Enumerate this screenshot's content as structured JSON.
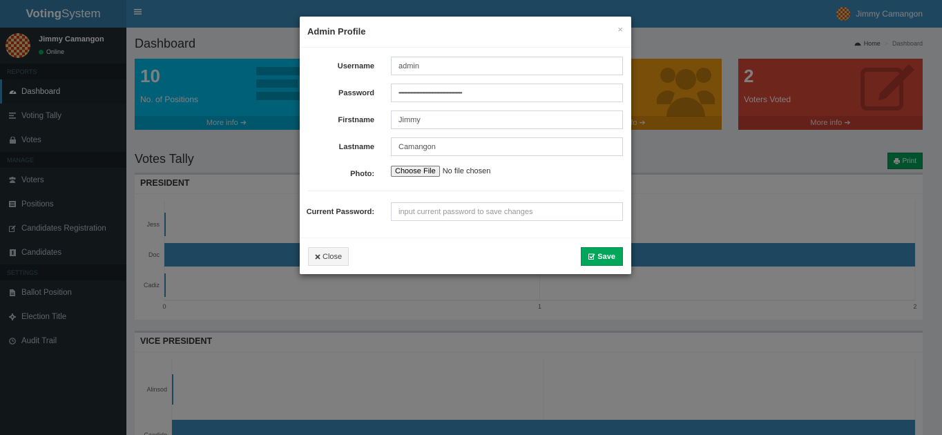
{
  "header": {
    "logo_bold": "Voting",
    "logo_rest": "System",
    "user_name": "Jimmy Camangon"
  },
  "sidebar": {
    "user_name": "Jimmy Camangon",
    "status": "Online",
    "sections": {
      "reports": "REPORTS",
      "manage": "MANAGE",
      "settings": "SETTINGS"
    },
    "items": [
      {
        "label": "Dashboard",
        "icon": "dashboard-icon"
      },
      {
        "label": "Voting Tally",
        "icon": "tally-icon"
      },
      {
        "label": "Votes",
        "icon": "lock-icon"
      },
      {
        "label": "Voters",
        "icon": "users-icon"
      },
      {
        "label": "Positions",
        "icon": "tasks-icon"
      },
      {
        "label": "Candidates Registration",
        "icon": "edit-icon"
      },
      {
        "label": "Candidates",
        "icon": "id-card-icon"
      },
      {
        "label": "Ballot Position",
        "icon": "file-icon"
      },
      {
        "label": "Election Title",
        "icon": "cog-icon"
      },
      {
        "label": "Audit Trail",
        "icon": "history-icon"
      }
    ]
  },
  "dashboard": {
    "title": "Dashboard",
    "breadcrumb": {
      "home": "Home",
      "current": "Dashboard"
    },
    "boxes": [
      {
        "number": "10",
        "label": "No. of Positions",
        "more": "More info",
        "color": "#00c0ef"
      },
      {
        "number": "",
        "label": "",
        "more": "fo",
        "color": "#f39c12"
      },
      {
        "number": "2",
        "label": "Voters Voted",
        "more": "More info",
        "color": "#dd4b39"
      }
    ],
    "tally_title": "Votes Tally",
    "print_label": "Print"
  },
  "chart_data": [
    {
      "type": "bar",
      "orientation": "horizontal",
      "title": "PRESIDENT",
      "categories": [
        "Jess",
        "Doc",
        "Cadiz"
      ],
      "values": [
        0,
        2,
        0
      ],
      "xlim": [
        0,
        2
      ],
      "xticks": [
        "0",
        "1",
        "2"
      ],
      "color": "#3c8dbc"
    },
    {
      "type": "bar",
      "orientation": "horizontal",
      "title": "VICE PRESIDENT",
      "categories": [
        "Alinsod",
        "Candido"
      ],
      "values": [
        0,
        2
      ],
      "xlim": [
        0,
        2
      ],
      "color": "#3c8dbc"
    }
  ],
  "modal": {
    "title": "Admin Profile",
    "close_x": "×",
    "fields": {
      "username_label": "Username",
      "username_value": "admin",
      "password_label": "Password",
      "password_value": "••••••••••••••••••••••••••••••••••••••••••••••••••••••••••••••••••••••",
      "firstname_label": "Firstname",
      "firstname_value": "Jimmy",
      "lastname_label": "Lastname",
      "lastname_value": "Camangon",
      "photo_label": "Photo:",
      "photo_button": "Choose File",
      "photo_status": "No file chosen",
      "current_password_label": "Current Password:",
      "current_password_placeholder": "input current password to save changes"
    },
    "close_label": "Close",
    "save_label": "Save"
  }
}
